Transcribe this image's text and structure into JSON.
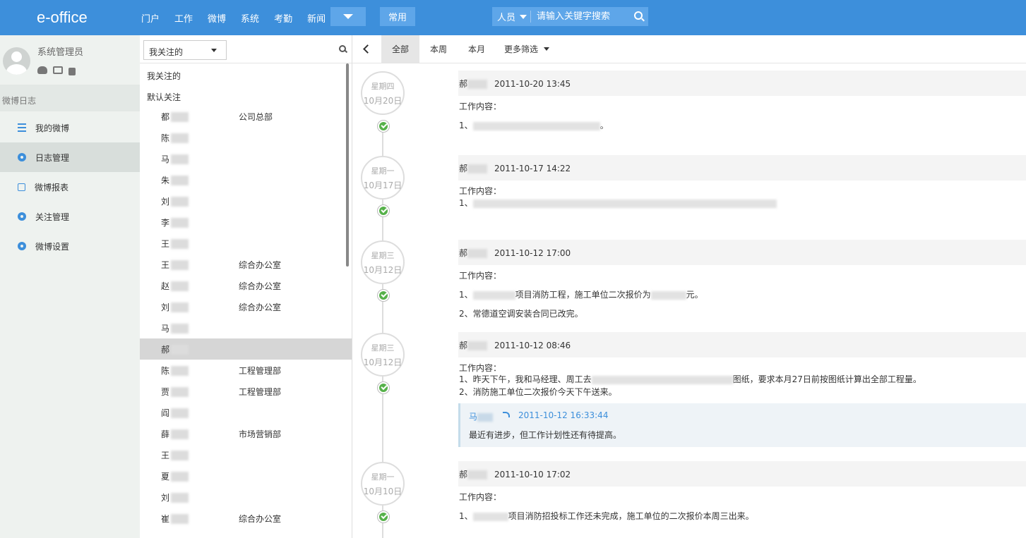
{
  "app": {
    "logo": "e-office"
  },
  "nav": {
    "items": [
      "门户",
      "工作",
      "微博",
      "系统",
      "考勤",
      "新闻"
    ],
    "common_label": "常用"
  },
  "search": {
    "type": "人员",
    "placeholder": "请输入关键字搜索"
  },
  "user": {
    "name": "系统管理员"
  },
  "sidebar": {
    "section": "微博日志",
    "items": [
      {
        "label": "我的微博",
        "icon": "list-icon"
      },
      {
        "label": "日志管理",
        "icon": "gear-icon"
      },
      {
        "label": "微博报表",
        "icon": "square-icon"
      },
      {
        "label": "关注管理",
        "icon": "gear-icon"
      },
      {
        "label": "微博设置",
        "icon": "gear-icon"
      }
    ]
  },
  "middle": {
    "select_value": "我关注的",
    "group1": "我关注的",
    "group2": "默认关注",
    "people": [
      {
        "name": "都",
        "dept": "公司总部"
      },
      {
        "name": "陈",
        "dept": ""
      },
      {
        "name": "马",
        "dept": ""
      },
      {
        "name": "朱",
        "dept": ""
      },
      {
        "name": "刘",
        "dept": ""
      },
      {
        "name": "李",
        "dept": ""
      },
      {
        "name": "王",
        "dept": ""
      },
      {
        "name": "王",
        "dept": "综合办公室"
      },
      {
        "name": "赵",
        "dept": "综合办公室"
      },
      {
        "name": "刘",
        "dept": "综合办公室"
      },
      {
        "name": "马",
        "dept": ""
      },
      {
        "name": "郝",
        "dept": ""
      },
      {
        "name": "陈",
        "dept": "工程管理部"
      },
      {
        "name": "贾",
        "dept": "工程管理部"
      },
      {
        "name": "阎",
        "dept": ""
      },
      {
        "name": "薛",
        "dept": "市场营销部"
      },
      {
        "name": "王",
        "dept": ""
      },
      {
        "name": "夏",
        "dept": ""
      },
      {
        "name": "刘",
        "dept": ""
      },
      {
        "name": "崔",
        "dept": "综合办公室"
      }
    ]
  },
  "right": {
    "tabs": [
      "全部",
      "本周",
      "本月",
      "更多筛选"
    ],
    "entries": [
      {
        "weekday": "星期四",
        "date": "10月20日",
        "author": "郝",
        "time": "2011-10-20 13:45",
        "label": "工作内容：",
        "lines": [
          "1、",
          "。"
        ]
      },
      {
        "weekday": "星期一",
        "date": "10月17日",
        "author": "郝",
        "time": "2011-10-17 14:22",
        "label": "工作内容：",
        "lines": [
          "1、"
        ]
      },
      {
        "weekday": "星期三",
        "date": "10月12日",
        "author": "郝",
        "time": "2011-10-12 17:00",
        "label": "工作内容：",
        "lines": [
          "1、",
          "项目消防工程，施工单位二次报价为",
          "元。",
          "2、常德道空调安装合同已改完。"
        ]
      },
      {
        "weekday": "星期三",
        "date": "10月12日",
        "author": "郝",
        "time": "2011-10-12 08:46",
        "label": "工作内容：",
        "lines": [
          "1、昨天下午，我和马经理、周工去",
          "图纸，要求本月27日前按图纸计算出全部工程量。",
          "2、消防施工单位二次报价今天下午送来。"
        ]
      },
      {
        "weekday": "星期一",
        "date": "10月10日",
        "author": "郝",
        "time": "2011-10-10 17:02",
        "label": "工作内容：",
        "lines": [
          "1、",
          "项目消防招投标工作还未完成，施工单位的二次报价本周三出来。"
        ]
      }
    ],
    "comment": {
      "who": "马",
      "time": "2011-10-12 16:33:44",
      "text": "最近有进步，但工作计划性还有待提高。"
    }
  }
}
